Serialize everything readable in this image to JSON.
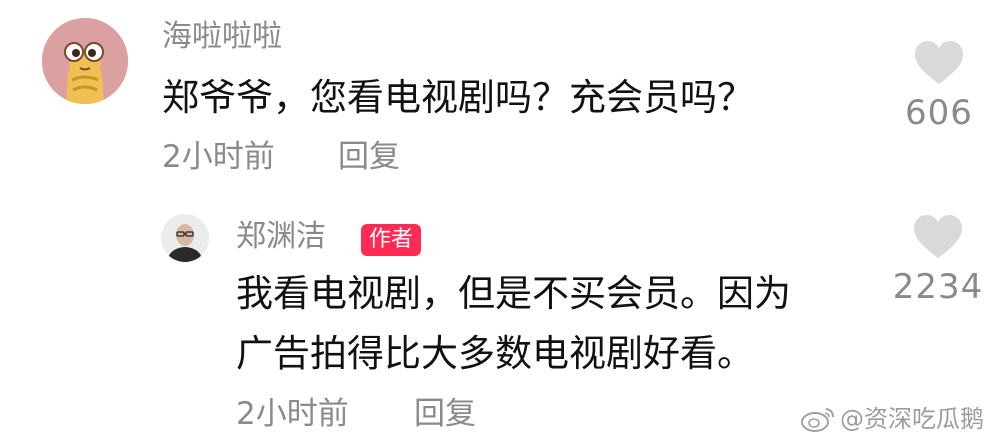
{
  "comment": {
    "username": "海啦啦啦",
    "text": "郑爷爷，您看电视剧吗？充会员吗？",
    "time": "2小时前",
    "reply_label": "回复",
    "likes": "606"
  },
  "reply": {
    "username": "郑渊洁",
    "badge": "作者",
    "text_line1": "我看电视剧，但是不买会员。因为",
    "text_line2": "广告拍得比大多数电视剧好看。",
    "time": "2小时前",
    "reply_label": "回复",
    "likes": "2234"
  },
  "watermark": {
    "text": "@资深吃瓜鹅"
  },
  "colors": {
    "badge": "#ff2b55",
    "heart": "#d9d9d9",
    "muted_text": "#8a8a8a"
  }
}
